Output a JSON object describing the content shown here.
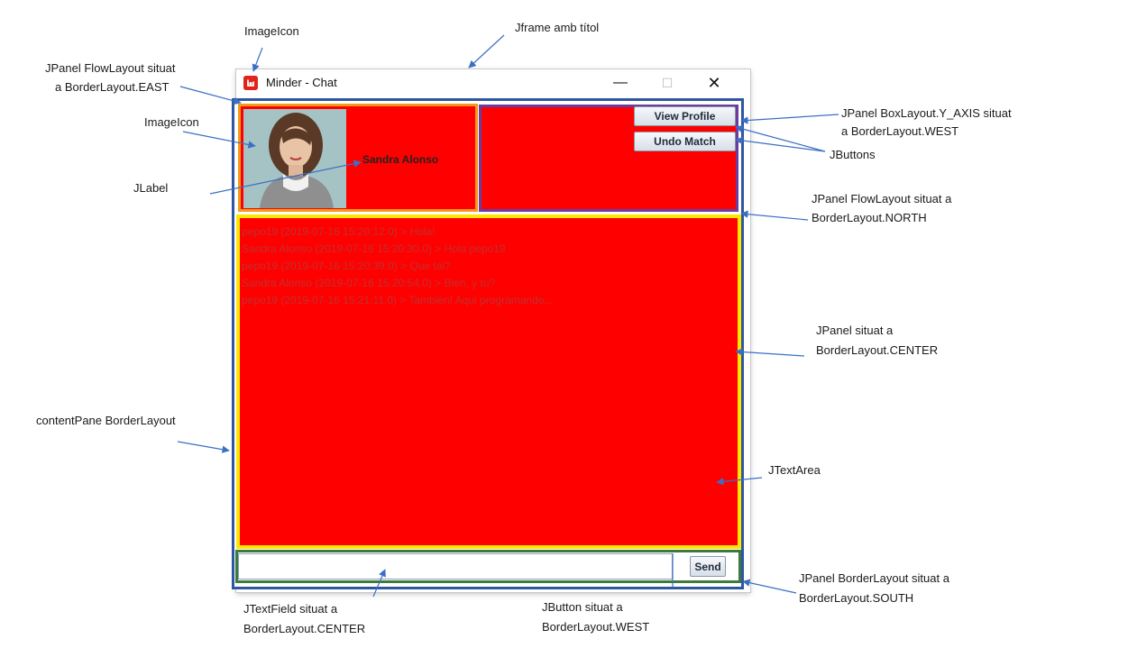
{
  "annotations": {
    "imageicon_top": "ImageIcon",
    "jframe": "Jframe amb títol",
    "flow_east_1": "JPanel FlowLayout situat",
    "flow_east_2": "a BorderLayout.EAST",
    "imageicon_left": "ImageIcon",
    "jlabel": "JLabel",
    "contentpane": "contentPane BorderLayout",
    "box_west_1": "JPanel BoxLayout.Y_AXIS situat",
    "box_west_2": "a BorderLayout.WEST",
    "jbuttons": "JButtons",
    "flow_north_1": "JPanel FlowLayout situat a",
    "flow_north_2": "BorderLayout.NORTH",
    "panel_center_1": "JPanel situat a",
    "panel_center_2": "BorderLayout.CENTER",
    "jtextarea": "JTextArea",
    "border_south_1": "JPanel BorderLayout situat a",
    "border_south_2": "BorderLayout.SOUTH",
    "textfield_1": "JTextField situat a",
    "textfield_2": "BorderLayout.CENTER",
    "button_west_1": "JButton situat a",
    "button_west_2": "BorderLayout.WEST"
  },
  "window": {
    "title": "Minder - Chat",
    "minimize": "—",
    "maximize": "☐",
    "close": "✕"
  },
  "profile": {
    "name": "Sandra Alonso"
  },
  "buttons": {
    "view_profile": "View Profile",
    "undo_match": "Undo Match",
    "send": "Send"
  },
  "chat": {
    "messages": [
      "pepo19 (2019-07-16 15:20:12.0) > Hola!",
      "Sandra Alonso (2019-07-16 15:20:30.0) > Hola pepo19",
      "pepo19 (2019-07-16 15:20:39.0) > Que tal?",
      "Sandra Alonso (2019-07-16 15:20:54.0) > Bien, y tu?",
      "pepo19 (2019-07-16 15:21:11.0) > Tambien! Aqui programando..."
    ]
  },
  "input": {
    "value": "",
    "placeholder": ""
  },
  "colors": {
    "content_border": "#2f56a0",
    "east_border": "#f39a1a",
    "west_border": "#6b3ca0",
    "center_border": "#ffe600",
    "south_border": "#3d7a3d",
    "panel_fill": "#ff0000",
    "arrow": "#3b6fc4"
  }
}
